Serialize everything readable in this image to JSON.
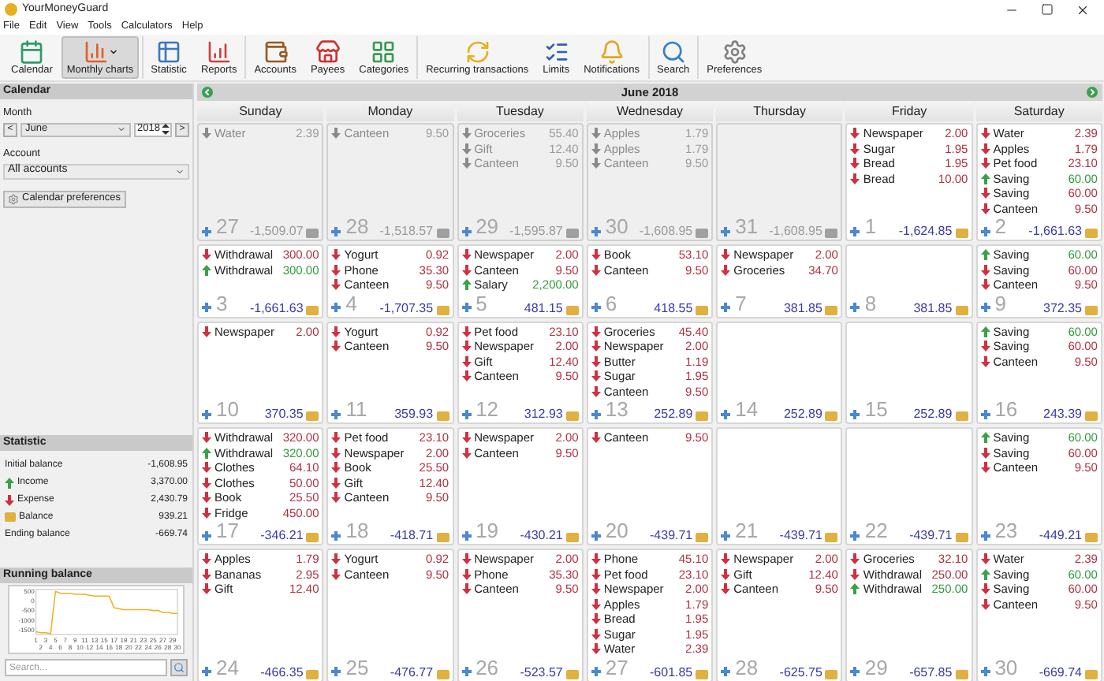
{
  "title_bar": {
    "title": "YourMoneyGuard"
  },
  "menu": [
    "File",
    "Edit",
    "View",
    "Tools",
    "Calculators",
    "Help"
  ],
  "toolbar": [
    [
      {
        "label": "Calendar",
        "selected": false,
        "dropdown": false
      },
      {
        "label": "Monthly charts",
        "selected": true,
        "dropdown": true
      }
    ],
    [
      {
        "label": "Statistic",
        "selected": false,
        "dropdown": false
      },
      {
        "label": "Reports",
        "selected": false,
        "dropdown": false
      }
    ],
    [
      {
        "label": "Accounts",
        "selected": false,
        "dropdown": false
      },
      {
        "label": "Payees",
        "selected": false,
        "dropdown": false
      },
      {
        "label": "Categories",
        "selected": false,
        "dropdown": false
      }
    ],
    [
      {
        "label": "Recurring transactions",
        "selected": false,
        "dropdown": false
      },
      {
        "label": "Limits",
        "selected": false,
        "dropdown": false
      },
      {
        "label": "Notifications",
        "selected": false,
        "dropdown": false
      }
    ],
    [
      {
        "label": "Search",
        "selected": false,
        "dropdown": false
      }
    ],
    [
      {
        "label": "Preferences",
        "selected": false,
        "dropdown": false
      }
    ]
  ],
  "left_panel": {
    "calendar": {
      "title": "Calendar",
      "month_label": "Month",
      "prev": "<",
      "month": "June",
      "year": "2018",
      "next": ">",
      "account_label": "Account",
      "account": "All accounts",
      "preferences_button": "Calendar preferences"
    },
    "statistic": {
      "title": "Statistic",
      "rows": [
        {
          "label": "Initial balance",
          "value": "-1,608.95",
          "kind": "plain"
        },
        {
          "label": "Income",
          "value": "3,370.00",
          "kind": "income"
        },
        {
          "label": "Expense",
          "value": "2,430.79",
          "kind": "expense"
        },
        {
          "label": "Balance",
          "value": "939.21",
          "kind": "balance"
        },
        {
          "label": "Ending balance",
          "value": "-669.74",
          "kind": "plain"
        }
      ]
    },
    "running_balance": {
      "title": "Running balance",
      "chart_data": {
        "type": "line",
        "x": [
          1,
          2,
          3,
          4,
          5,
          6,
          7,
          8,
          9,
          10,
          11,
          12,
          13,
          14,
          15,
          16,
          17,
          18,
          19,
          20,
          21,
          22,
          23,
          24,
          25,
          26,
          27,
          28,
          29,
          30
        ],
        "series": [
          {
            "color": "#f0b020",
            "values": [
              -1600,
              -1650,
              -1650,
              -1700,
              500,
              400,
              400,
              400,
              350,
              350,
              350,
              300,
              250,
              250,
              250,
              250,
              -350,
              -400,
              -450,
              -450,
              -450,
              -450,
              -450,
              -450,
              -500,
              -500,
              -600,
              -600,
              -650,
              -650
            ]
          }
        ],
        "xlim": [
          1,
          30
        ],
        "ylim": [
          -1750,
          600
        ],
        "yticks": [
          500,
          0,
          -500,
          -1000,
          -1500
        ],
        "xticks": [
          1,
          2,
          3,
          4,
          5,
          6,
          7,
          8,
          9,
          10,
          11,
          12,
          13,
          14,
          15,
          16,
          17,
          18,
          19,
          20,
          21,
          22,
          23,
          24,
          25,
          26,
          27,
          28,
          29,
          30
        ]
      }
    },
    "search": {
      "placeholder": "Search..."
    }
  },
  "calendar": {
    "title": "June 2018",
    "weekdays": [
      "Sunday",
      "Monday",
      "Tuesday",
      "Wednesday",
      "Thursday",
      "Friday",
      "Saturday"
    ],
    "weeks": [
      [
        {
          "day": "27",
          "current_month": false,
          "balance": "-1,509.07",
          "entries": [
            {
              "name": "Water",
              "amount": "2.39",
              "kind": "expense"
            }
          ]
        },
        {
          "day": "28",
          "current_month": false,
          "balance": "-1,518.57",
          "entries": [
            {
              "name": "Canteen",
              "amount": "9.50",
              "kind": "expense"
            }
          ]
        },
        {
          "day": "29",
          "current_month": false,
          "balance": "-1,595.87",
          "entries": [
            {
              "name": "Groceries",
              "amount": "55.40",
              "kind": "expense"
            },
            {
              "name": "Gift",
              "amount": "12.40",
              "kind": "expense"
            },
            {
              "name": "Canteen",
              "amount": "9.50",
              "kind": "expense"
            }
          ]
        },
        {
          "day": "30",
          "current_month": false,
          "balance": "-1,608.95",
          "entries": [
            {
              "name": "Apples",
              "amount": "1.79",
              "kind": "expense"
            },
            {
              "name": "Apples",
              "amount": "1.79",
              "kind": "expense"
            },
            {
              "name": "Canteen",
              "amount": "9.50",
              "kind": "expense"
            }
          ]
        },
        {
          "day": "31",
          "current_month": false,
          "balance": "-1,608.95"
        },
        {
          "day": "1",
          "current_month": true,
          "balance": "-1,624.85",
          "entries": [
            {
              "name": "Newspaper",
              "amount": "2.00",
              "kind": "expense"
            },
            {
              "name": "Sugar",
              "amount": "1.95",
              "kind": "expense"
            },
            {
              "name": "Bread",
              "amount": "1.95",
              "kind": "expense"
            },
            {
              "name": "Bread",
              "amount": "10.00",
              "kind": "expense"
            }
          ]
        },
        {
          "day": "2",
          "current_month": true,
          "balance": "-1,661.63",
          "entries": [
            {
              "name": "Water",
              "amount": "2.39",
              "kind": "expense"
            },
            {
              "name": "Apples",
              "amount": "1.79",
              "kind": "expense"
            },
            {
              "name": "Pet food",
              "amount": "23.10",
              "kind": "expense"
            },
            {
              "name": "Saving",
              "amount": "60.00",
              "kind": "income"
            },
            {
              "name": "Saving",
              "amount": "60.00",
              "kind": "expense"
            },
            {
              "name": "Canteen",
              "amount": "9.50",
              "kind": "expense"
            }
          ]
        }
      ],
      [
        {
          "day": "3",
          "current_month": true,
          "balance": "-1,661.63",
          "entries": [
            {
              "name": "Withdrawal",
              "amount": "300.00",
              "kind": "expense"
            },
            {
              "name": "Withdrawal",
              "amount": "300.00",
              "kind": "income"
            }
          ]
        },
        {
          "day": "4",
          "current_month": true,
          "balance": "-1,707.35",
          "entries": [
            {
              "name": "Yogurt",
              "amount": "0.92",
              "kind": "expense"
            },
            {
              "name": "Phone",
              "amount": "35.30",
              "kind": "expense"
            },
            {
              "name": "Canteen",
              "amount": "9.50",
              "kind": "expense"
            }
          ]
        },
        {
          "day": "5",
          "current_month": true,
          "balance": "481.15",
          "entries": [
            {
              "name": "Newspaper",
              "amount": "2.00",
              "kind": "expense"
            },
            {
              "name": "Canteen",
              "amount": "9.50",
              "kind": "expense"
            },
            {
              "name": "Salary",
              "amount": "2,200.00",
              "kind": "income"
            }
          ]
        },
        {
          "day": "6",
          "current_month": true,
          "balance": "418.55",
          "entries": [
            {
              "name": "Book",
              "amount": "53.10",
              "kind": "expense"
            },
            {
              "name": "Canteen",
              "amount": "9.50",
              "kind": "expense"
            }
          ]
        },
        {
          "day": "7",
          "current_month": true,
          "balance": "381.85",
          "entries": [
            {
              "name": "Newspaper",
              "amount": "2.00",
              "kind": "expense"
            },
            {
              "name": "Groceries",
              "amount": "34.70",
              "kind": "expense"
            }
          ]
        },
        {
          "day": "8",
          "current_month": true,
          "balance": "381.85"
        },
        {
          "day": "9",
          "current_month": true,
          "balance": "372.35",
          "entries": [
            {
              "name": "Saving",
              "amount": "60.00",
              "kind": "income"
            },
            {
              "name": "Saving",
              "amount": "60.00",
              "kind": "expense"
            },
            {
              "name": "Canteen",
              "amount": "9.50",
              "kind": "expense"
            }
          ]
        }
      ],
      [
        {
          "day": "10",
          "current_month": true,
          "balance": "370.35",
          "entries": [
            {
              "name": "Newspaper",
              "amount": "2.00",
              "kind": "expense"
            }
          ]
        },
        {
          "day": "11",
          "current_month": true,
          "balance": "359.93",
          "entries": [
            {
              "name": "Yogurt",
              "amount": "0.92",
              "kind": "expense"
            },
            {
              "name": "Canteen",
              "amount": "9.50",
              "kind": "expense"
            }
          ]
        },
        {
          "day": "12",
          "current_month": true,
          "balance": "312.93",
          "entries": [
            {
              "name": "Pet food",
              "amount": "23.10",
              "kind": "expense"
            },
            {
              "name": "Newspaper",
              "amount": "2.00",
              "kind": "expense"
            },
            {
              "name": "Gift",
              "amount": "12.40",
              "kind": "expense"
            },
            {
              "name": "Canteen",
              "amount": "9.50",
              "kind": "expense"
            }
          ]
        },
        {
          "day": "13",
          "current_month": true,
          "balance": "252.89",
          "entries": [
            {
              "name": "Groceries",
              "amount": "45.40",
              "kind": "expense"
            },
            {
              "name": "Newspaper",
              "amount": "2.00",
              "kind": "expense"
            },
            {
              "name": "Butter",
              "amount": "1.19",
              "kind": "expense"
            },
            {
              "name": "Sugar",
              "amount": "1.95",
              "kind": "expense"
            },
            {
              "name": "Canteen",
              "amount": "9.50",
              "kind": "expense"
            }
          ]
        },
        {
          "day": "14",
          "current_month": true,
          "balance": "252.89"
        },
        {
          "day": "15",
          "current_month": true,
          "balance": "252.89"
        },
        {
          "day": "16",
          "current_month": true,
          "balance": "243.39",
          "entries": [
            {
              "name": "Saving",
              "amount": "60.00",
              "kind": "income"
            },
            {
              "name": "Saving",
              "amount": "60.00",
              "kind": "expense"
            },
            {
              "name": "Canteen",
              "amount": "9.50",
              "kind": "expense"
            }
          ]
        }
      ],
      [
        {
          "day": "17",
          "current_month": true,
          "balance": "-346.21",
          "entries": [
            {
              "name": "Withdrawal",
              "amount": "320.00",
              "kind": "expense"
            },
            {
              "name": "Withdrawal",
              "amount": "320.00",
              "kind": "income"
            },
            {
              "name": "Clothes",
              "amount": "64.10",
              "kind": "expense"
            },
            {
              "name": "Clothes",
              "amount": "50.00",
              "kind": "expense"
            },
            {
              "name": "Book",
              "amount": "25.50",
              "kind": "expense"
            },
            {
              "name": "Fridge",
              "amount": "450.00",
              "kind": "expense"
            }
          ]
        },
        {
          "day": "18",
          "current_month": true,
          "balance": "-418.71",
          "entries": [
            {
              "name": "Pet food",
              "amount": "23.10",
              "kind": "expense"
            },
            {
              "name": "Newspaper",
              "amount": "2.00",
              "kind": "expense"
            },
            {
              "name": "Book",
              "amount": "25.50",
              "kind": "expense"
            },
            {
              "name": "Gift",
              "amount": "12.40",
              "kind": "expense"
            },
            {
              "name": "Canteen",
              "amount": "9.50",
              "kind": "expense"
            }
          ]
        },
        {
          "day": "19",
          "current_month": true,
          "balance": "-430.21",
          "entries": [
            {
              "name": "Newspaper",
              "amount": "2.00",
              "kind": "expense"
            },
            {
              "name": "Canteen",
              "amount": "9.50",
              "kind": "expense"
            }
          ]
        },
        {
          "day": "20",
          "current_month": true,
          "balance": "-439.71",
          "entries": [
            {
              "name": "Canteen",
              "amount": "9.50",
              "kind": "expense"
            }
          ]
        },
        {
          "day": "21",
          "current_month": true,
          "balance": "-439.71"
        },
        {
          "day": "22",
          "current_month": true,
          "balance": "-439.71"
        },
        {
          "day": "23",
          "current_month": true,
          "balance": "-449.21",
          "entries": [
            {
              "name": "Saving",
              "amount": "60.00",
              "kind": "income"
            },
            {
              "name": "Saving",
              "amount": "60.00",
              "kind": "expense"
            },
            {
              "name": "Canteen",
              "amount": "9.50",
              "kind": "expense"
            }
          ]
        }
      ],
      [
        {
          "day": "24",
          "current_month": true,
          "balance": "-466.35",
          "entries": [
            {
              "name": "Apples",
              "amount": "1.79",
              "kind": "expense"
            },
            {
              "name": "Bananas",
              "amount": "2.95",
              "kind": "expense"
            },
            {
              "name": "Gift",
              "amount": "12.40",
              "kind": "expense"
            }
          ]
        },
        {
          "day": "25",
          "current_month": true,
          "balance": "-476.77",
          "entries": [
            {
              "name": "Yogurt",
              "amount": "0.92",
              "kind": "expense"
            },
            {
              "name": "Canteen",
              "amount": "9.50",
              "kind": "expense"
            }
          ]
        },
        {
          "day": "26",
          "current_month": true,
          "balance": "-523.57",
          "entries": [
            {
              "name": "Newspaper",
              "amount": "2.00",
              "kind": "expense"
            },
            {
              "name": "Phone",
              "amount": "35.30",
              "kind": "expense"
            },
            {
              "name": "Canteen",
              "amount": "9.50",
              "kind": "expense"
            }
          ]
        },
        {
          "day": "27",
          "current_month": true,
          "balance": "-601.85",
          "entries": [
            {
              "name": "Phone",
              "amount": "45.10",
              "kind": "expense"
            },
            {
              "name": "Pet food",
              "amount": "23.10",
              "kind": "expense"
            },
            {
              "name": "Newspaper",
              "amount": "2.00",
              "kind": "expense"
            },
            {
              "name": "Apples",
              "amount": "1.79",
              "kind": "expense"
            },
            {
              "name": "Bread",
              "amount": "1.95",
              "kind": "expense"
            },
            {
              "name": "Sugar",
              "amount": "1.95",
              "kind": "expense"
            },
            {
              "name": "Water",
              "amount": "2.39",
              "kind": "expense"
            }
          ]
        },
        {
          "day": "28",
          "current_month": true,
          "balance": "-625.75",
          "entries": [
            {
              "name": "Newspaper",
              "amount": "2.00",
              "kind": "expense"
            },
            {
              "name": "Gift",
              "amount": "12.40",
              "kind": "expense"
            },
            {
              "name": "Canteen",
              "amount": "9.50",
              "kind": "expense"
            }
          ]
        },
        {
          "day": "29",
          "current_month": true,
          "balance": "-657.85",
          "entries": [
            {
              "name": "Groceries",
              "amount": "32.10",
              "kind": "expense"
            },
            {
              "name": "Withdrawal",
              "amount": "250.00",
              "kind": "expense"
            },
            {
              "name": "Withdrawal",
              "amount": "250.00",
              "kind": "income"
            }
          ]
        },
        {
          "day": "30",
          "current_month": true,
          "balance": "-669.74",
          "entries": [
            {
              "name": "Water",
              "amount": "2.39",
              "kind": "expense"
            },
            {
              "name": "Saving",
              "amount": "60.00",
              "kind": "income"
            },
            {
              "name": "Saving",
              "amount": "60.00",
              "kind": "expense"
            },
            {
              "name": "Canteen",
              "amount": "9.50",
              "kind": "expense"
            }
          ]
        }
      ]
    ]
  }
}
